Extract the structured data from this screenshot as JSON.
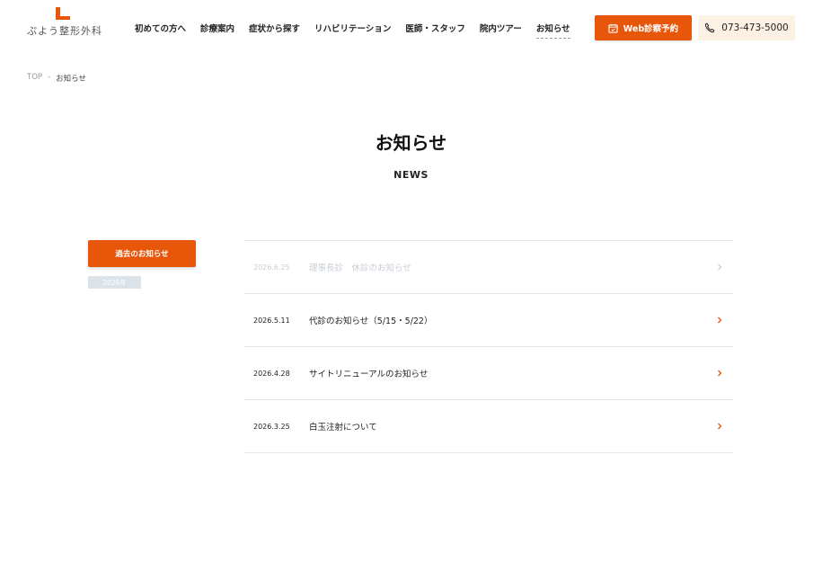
{
  "brand": {
    "logo_text": "ぷよう整形外科"
  },
  "nav": {
    "items": [
      {
        "label": "初めての方へ"
      },
      {
        "label": "診療案内"
      },
      {
        "label": "症状から探す"
      },
      {
        "label": "リハビリテーション"
      },
      {
        "label": "医師・スタッフ"
      },
      {
        "label": "院内ツアー"
      },
      {
        "label": "お知らせ"
      }
    ],
    "active_index": 6
  },
  "actions": {
    "reserve_label": "Web診察予約",
    "phone": "073-473-5000"
  },
  "breadcrumb": {
    "home": "TOP",
    "separator": "-",
    "current": "お知らせ"
  },
  "page": {
    "title": "お知らせ",
    "subtitle": "NEWS"
  },
  "sidebar": {
    "archive_label": "過去のお知らせ",
    "year_label": "2026年"
  },
  "news": [
    {
      "date": "2026.6.25",
      "title": "理事長診　休診のお知らせ"
    },
    {
      "date": "2026.5.11",
      "title": "代診のお知らせ（5/15・5/22）"
    },
    {
      "date": "2026.4.28",
      "title": "サイトリニューアルのお知らせ"
    },
    {
      "date": "2026.3.25",
      "title": "白玉注射について"
    }
  ],
  "colors": {
    "accent": "#e8560a",
    "accent_light": "#fdf1e4",
    "muted": "#c7ced6"
  }
}
